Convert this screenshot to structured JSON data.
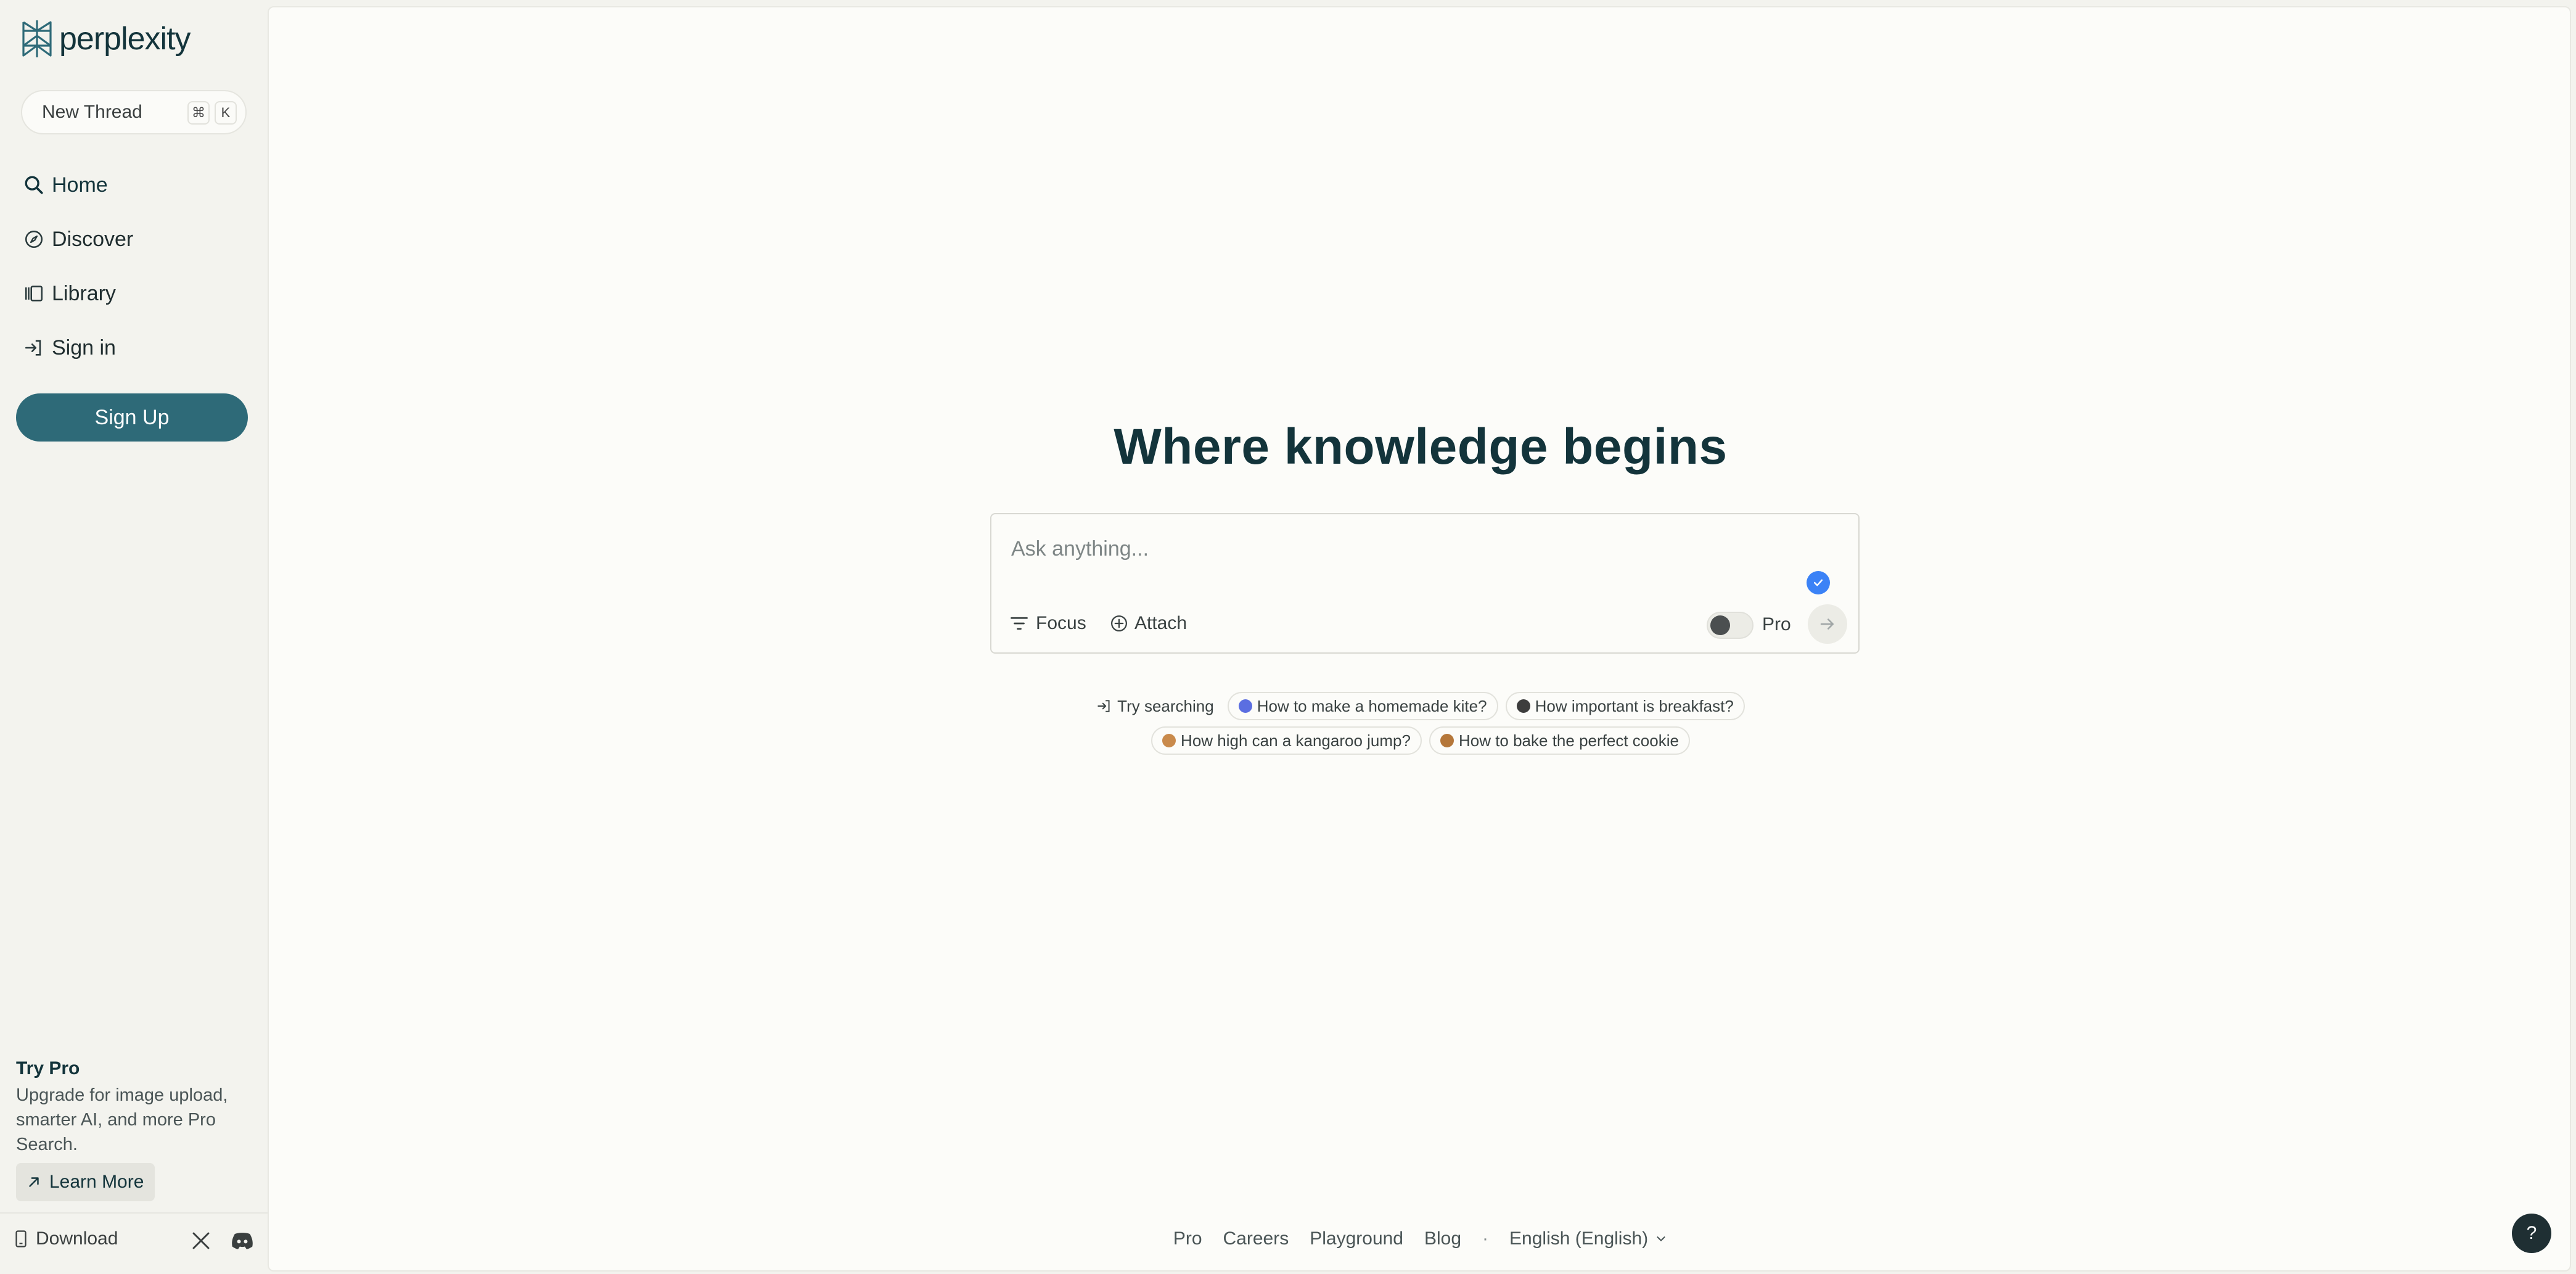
{
  "brand": {
    "name": "perplexity",
    "accent": "#2e6a78"
  },
  "sidebar": {
    "new_thread": {
      "label": "New Thread",
      "shortcut_keys": [
        "⌘",
        "K"
      ]
    },
    "nav": [
      {
        "label": "Home",
        "icon": "search-icon"
      },
      {
        "label": "Discover",
        "icon": "compass-icon"
      },
      {
        "label": "Library",
        "icon": "library-icon"
      },
      {
        "label": "Sign in",
        "icon": "sign-in-icon"
      }
    ],
    "signup_label": "Sign Up",
    "try_pro": {
      "title": "Try Pro",
      "description": "Upgrade for image upload, smarter AI, and more Pro Search.",
      "learn_more": "Learn More"
    },
    "download_label": "Download"
  },
  "main": {
    "headline": "Where knowledge begins",
    "search": {
      "placeholder": "Ask anything...",
      "focus_label": "Focus",
      "attach_label": "Attach",
      "pro_label": "Pro"
    },
    "suggestions": {
      "try_label": "Try searching",
      "items": [
        "How to make a homemade kite?",
        "How important is breakfast?",
        "How high can a kangaroo jump?",
        "How to bake the perfect cookie"
      ]
    },
    "footer": {
      "links": [
        "Pro",
        "Careers",
        "Playground",
        "Blog"
      ],
      "separator": "·",
      "language": "English (English)"
    },
    "help_label": "?"
  }
}
